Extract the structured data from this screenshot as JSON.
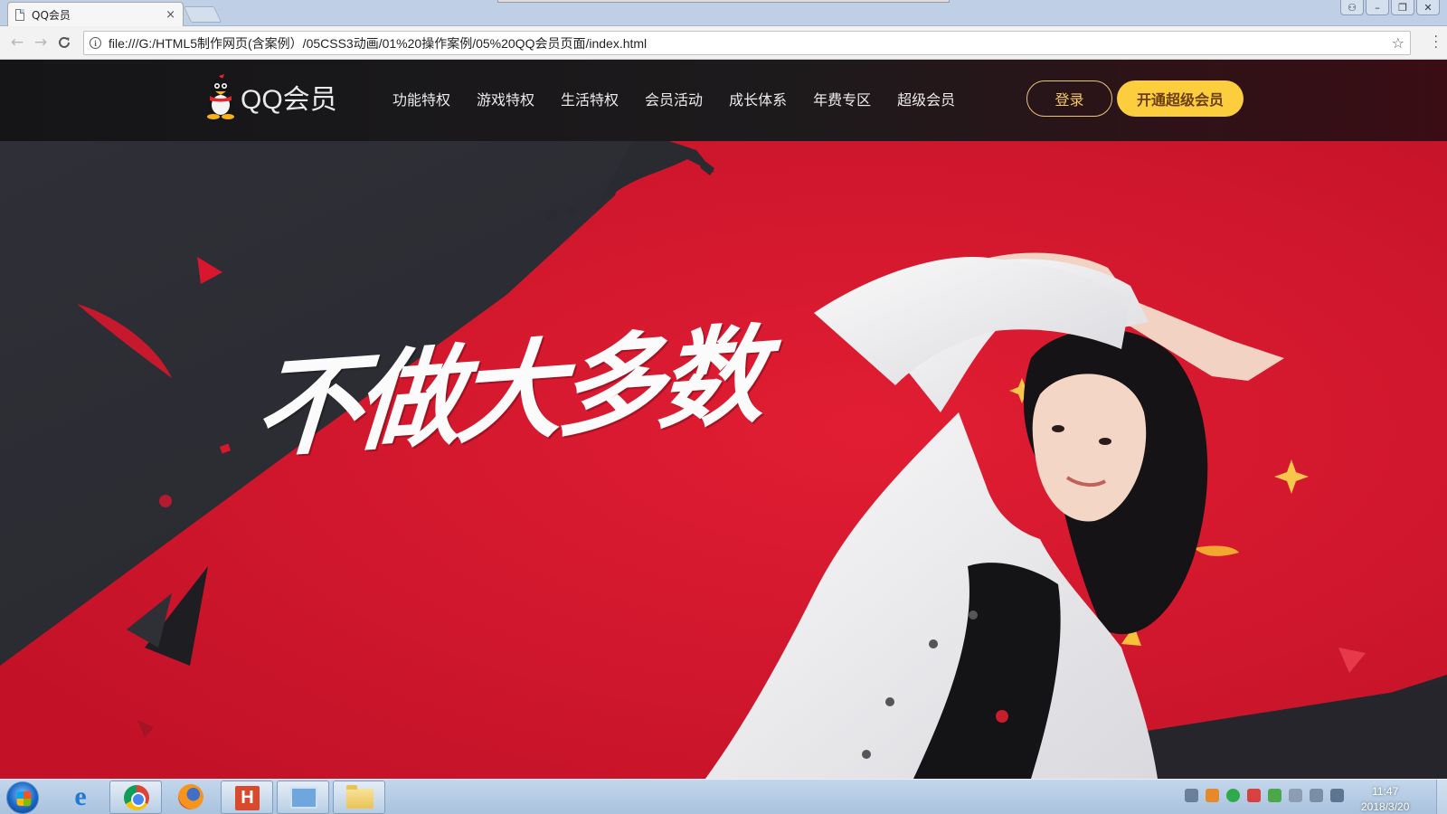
{
  "browser": {
    "tab_title": "QQ会员",
    "tab_close": "×",
    "url": "file:///G:/HTML5制作网页(含案例）/05CSS3动画/01%20操作案例/05%20QQ会员页面/index.html",
    "back_glyph": "←",
    "forward_glyph": "→",
    "reload_glyph": "C",
    "info_glyph": "i",
    "star_glyph": "☆",
    "win_buttons": [
      "⚇",
      "–",
      "❐",
      "✕"
    ]
  },
  "site": {
    "logo_text": "QQ会员",
    "nav": [
      "功能特权",
      "游戏特权",
      "生活特权",
      "会员活动",
      "成长体系",
      "年费专区",
      "超级会员"
    ],
    "login_label": "登录",
    "vip_label": "开通超级会员",
    "slogan": "不做大多数",
    "colors": {
      "hero_red": "#d8172e",
      "header_dark": "#1a1a1c",
      "gold": "#fccd3c",
      "gold_border": "#e8c57a"
    }
  },
  "taskbar": {
    "apps": [
      "internet-explorer",
      "chrome",
      "firefox",
      "hbuilder",
      "remote-desktop",
      "file-explorer"
    ],
    "active_app": "chrome",
    "clock_time": "11:47",
    "clock_date": "2018/3/20"
  }
}
